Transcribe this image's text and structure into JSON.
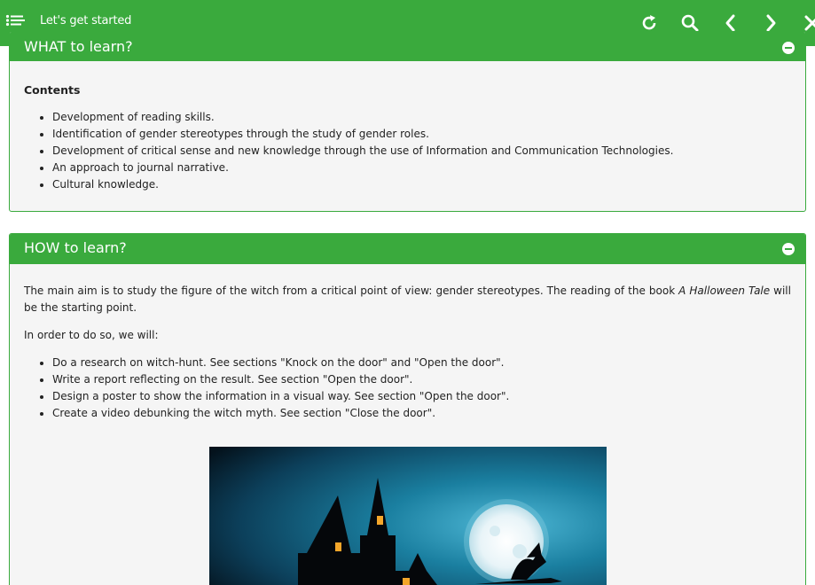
{
  "topbar": {
    "title": "Let's get started",
    "icons": [
      "list-menu-icon",
      "refresh-icon",
      "search-icon",
      "chevron-left-icon",
      "chevron-right-icon",
      "close-icon"
    ]
  },
  "what_panel": {
    "title": "WHAT to learn?",
    "contents_heading": "Contents",
    "items": [
      "Development of reading skills.",
      "Identification of gender stereotypes through the study of gender roles.",
      "Development of critical sense and new knowledge through the use of Information and Communication Technologies.",
      "An approach to journal narrative.",
      "Cultural knowledge."
    ]
  },
  "how_panel": {
    "title": "HOW to learn?",
    "intro_before": "The main aim is to study the figure of the witch from a critical point of view: gender stereotypes. The reading of the book ",
    "intro_book": "A Halloween Tale",
    "intro_after": " will be the starting point.",
    "todo": "In order to do so, we will:",
    "items": [
      "Do a research on witch-hunt. See sections \"Knock on the door\" and \"Open the door\".",
      "Write a report reflecting on the result. See section \"Open the door\".",
      "Design a poster to show the information in a visual way. See section \"Open the door\".",
      "Create a video debunking the witch myth. See section \"Close the door\"."
    ]
  },
  "colors": {
    "accent_green": "#3aaa3d",
    "panel_bg": "#f5f5f5",
    "sky_blue": "#1a7fa0"
  }
}
